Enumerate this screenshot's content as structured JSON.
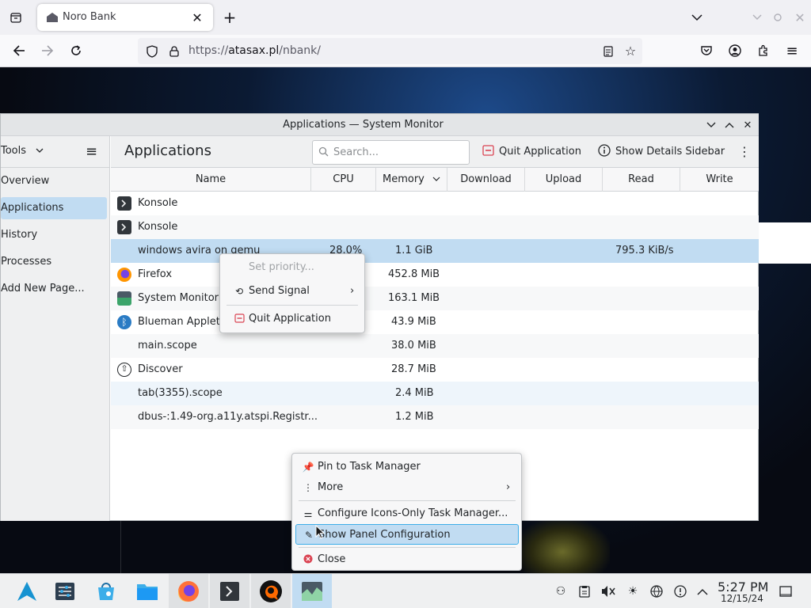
{
  "browser": {
    "tab_title": "Noro Bank",
    "url_prefix": "https://",
    "url_domain": "atasax.pl",
    "url_path": "/nbank/"
  },
  "sysmon": {
    "window_title": "Applications — System Monitor",
    "tools_label": "Tools",
    "heading": "Applications",
    "search_placeholder": "Search...",
    "quit_label": "Quit Application",
    "details_label": "Show Details Sidebar",
    "sidebar": [
      {
        "label": "Overview"
      },
      {
        "label": "Applications"
      },
      {
        "label": "History"
      },
      {
        "label": "Processes"
      },
      {
        "label": "Add New Page..."
      }
    ],
    "columns": [
      "Name",
      "CPU",
      "Memory",
      "Download",
      "Upload",
      "Read",
      "Write"
    ],
    "rows": [
      {
        "name": "Konsole",
        "cpu": "",
        "memory": "",
        "read": ""
      },
      {
        "name": "Konsole",
        "cpu": "",
        "memory": "",
        "read": ""
      },
      {
        "name": "windows avira on qemu",
        "cpu": "28.0%",
        "memory": "1.1 GiB",
        "read": "795.3 KiB/s"
      },
      {
        "name": "Firefox",
        "cpu": "",
        "memory": "452.8 MiB",
        "read": ""
      },
      {
        "name": "System Monitor",
        "cpu": "",
        "memory": "163.1 MiB",
        "read": ""
      },
      {
        "name": "Blueman Applet",
        "cpu": "",
        "memory": "43.9 MiB",
        "read": ""
      },
      {
        "name": "main.scope",
        "cpu": "",
        "memory": "38.0 MiB",
        "read": ""
      },
      {
        "name": "Discover",
        "cpu": "",
        "memory": "28.7 MiB",
        "read": ""
      },
      {
        "name": "tab(3355).scope",
        "cpu": "",
        "memory": "2.4 MiB",
        "read": ""
      },
      {
        "name": "dbus-:1.49-org.a11y.atspi.Registr...",
        "cpu": "",
        "memory": "1.2 MiB",
        "read": ""
      }
    ]
  },
  "proc_menu": {
    "set_priority": "Set priority...",
    "send_signal": "Send Signal",
    "quit": "Quit Application"
  },
  "task_menu": {
    "pin": "Pin to Task Manager",
    "more": "More",
    "configure": "Configure Icons-Only Task Manager...",
    "show_panel": "Show Panel Configuration",
    "close": "Close"
  },
  "taskbar": {
    "time": "5:27 PM",
    "date": "12/15/24"
  },
  "colors": {
    "selection": "#c1dcf2",
    "accent": "#3daee9",
    "close_red": "#da4453"
  }
}
